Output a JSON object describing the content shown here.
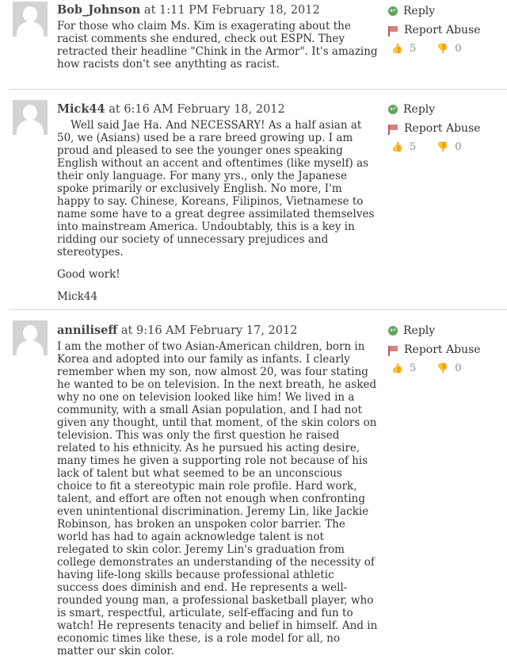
{
  "comments": [
    {
      "username": "Bob_Johnson",
      "timestamp": "at 1:11 PM February 18, 2012",
      "paragraphs": [
        "For those who claim Ms. Kim is exagerating about the racist comments she endured, check out ESPN.  They retracted their headline \"Chink in the Armor\".  It's amazing how racists don't see anythting as racist."
      ],
      "reply_label": "Reply",
      "report_label": "Report Abuse",
      "likes": "5",
      "dislikes": "0"
    },
    {
      "username": "Mick44",
      "timestamp": "at 6:16 AM February 18, 2012",
      "paragraphs": [
        "    Well said Jae Ha. And NECESSARY! As a half asian at 50, we (Asians) used be a rare breed growing up. I am proud and pleased to see the younger ones speaking English without an accent and oftentimes (like myself) as their only language. For many yrs., only the Japanese spoke primarily or exclusively English. No more, I'm happy to say. Chinese, Koreans, Filipinos, Vietnamese to name some have to a great degree assimilated themselves into mainstream America. Undoubtably, this is a key in ridding our society of unnecessary prejudices and stereotypes.",
        "Good work!",
        "Mick44"
      ],
      "reply_label": "Reply",
      "report_label": "Report Abuse",
      "likes": "5",
      "dislikes": "0"
    },
    {
      "username": "anniliseff",
      "timestamp": "at 9:16 AM February 17, 2012",
      "paragraphs": [
        "I am the mother of two Asian-American children, born in Korea and adopted into our family as infants.  I clearly remember when my son, now almost 20, was four stating he wanted to be on television. In the next breath, he asked why no one on television looked like him! We lived in a community, with a small Asian population, and I had not given any thought, until that moment, of the skin colors on television. This was only the first question he raised related to his ethnicity. As he pursued his acting desire, many times he given a supporting role not because of his lack of talent but what seemed to be an unconscious choice to fit a stereotypic main role profile. Hard work, talent, and effort are often not enough when confronting even unintentional discrimination. Jeremy Lin, like Jackie Robinson, has broken an unspoken color barrier. The world has had to again acknowledge talent is not relegated to skin color. Jeremy Lin's graduation from college demonstrates an understanding of the necessity of having life-long skills because professional athletic success does diminish and end. He represents a well-rounded young man, a professional basketball player, who is smart, respectful, articulate, self-effacing and fun to watch! He represents tenacity and belief in himself.  And in economic times like these, is a role model for all, no matter our skin color."
      ],
      "reply_label": "Reply",
      "report_label": "Report Abuse",
      "likes": "5",
      "dislikes": "0"
    }
  ],
  "icons": {
    "reply": "reply-icon",
    "report": "flag-icon",
    "like": "thumbs-up-icon",
    "dislike": "thumbs-down-icon",
    "avatar": "default-user-avatar"
  },
  "colors": {
    "reply_icon": "#5fa55a",
    "report_icon": "#d98080",
    "vote_icon": "#e0b8b8",
    "divider": "#d8d8d8"
  }
}
